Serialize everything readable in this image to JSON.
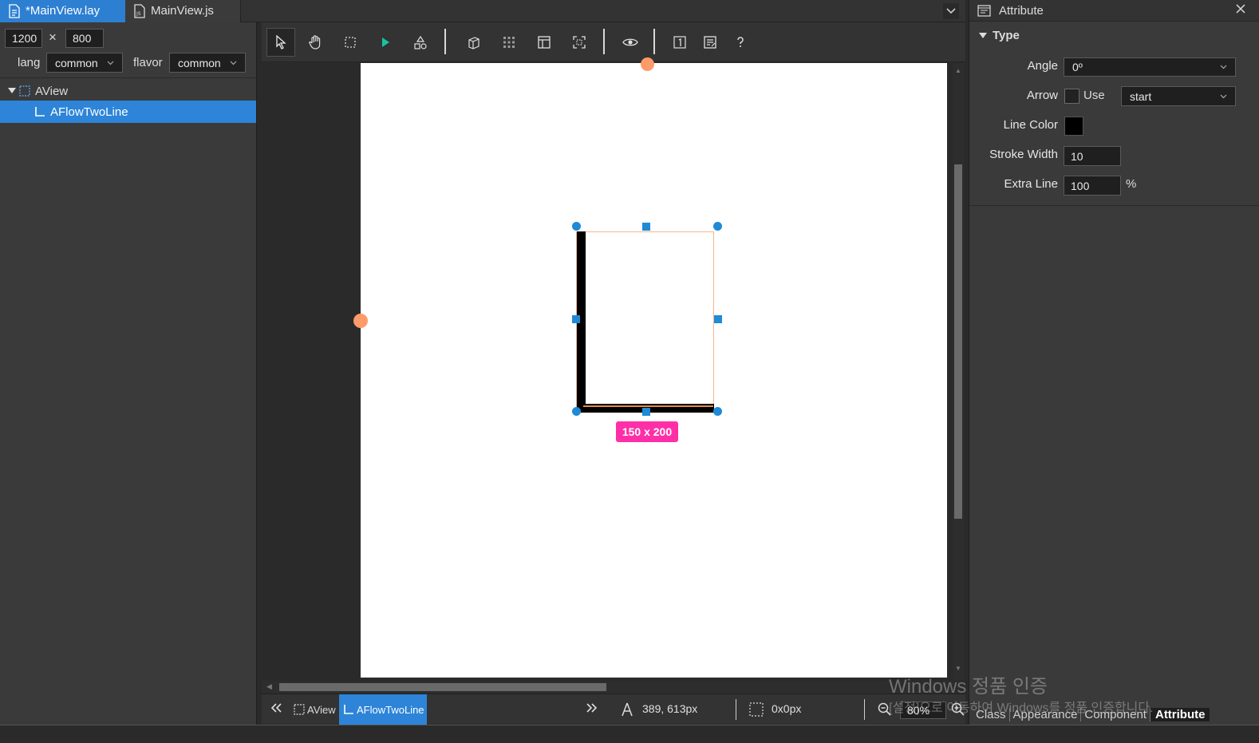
{
  "tabs": [
    {
      "label": "*MainView.lay",
      "active": true
    },
    {
      "label": "MainView.js",
      "active": false
    }
  ],
  "size": {
    "width": "1200",
    "times": "×",
    "height": "800"
  },
  "lang": {
    "label": "lang",
    "value": "common"
  },
  "flavor": {
    "label": "flavor",
    "value": "common"
  },
  "tree": [
    {
      "label": "AView",
      "selected": false
    },
    {
      "label": "AFlowTwoLine",
      "selected": true
    }
  ],
  "canvas": {
    "size_badge": "150 x 200"
  },
  "scroll": {
    "horizontal_fraction": 0.47,
    "vertical_fraction": 0.57
  },
  "status": {
    "crumbs": [
      "AView",
      "AFlowTwoLine"
    ],
    "cursor_pos": "389, 613px",
    "selection_size": "0x0px",
    "zoom": "80%"
  },
  "attribute_panel": {
    "title": "Attribute",
    "section": "Type",
    "angle_label": "Angle",
    "angle_value": "0º",
    "arrow_label": "Arrow",
    "arrow_use": "Use",
    "arrow_value": "start",
    "line_color_label": "Line Color",
    "line_color": "#000000",
    "stroke_width_label": "Stroke Width",
    "stroke_width": "10",
    "extra_line_label": "Extra Line",
    "extra_line": "100",
    "extra_line_unit": "%"
  },
  "bottom_tabs": [
    "Class",
    "Appearance",
    "Component",
    "Attribute"
  ],
  "watermark": {
    "line1": "Windows 정품 인증",
    "line2": "[설정]으로 이동하여 Windows를 정품 인증합니다."
  },
  "colors": {
    "accent": "#2d84d8",
    "handle": "#1f8ad6",
    "anchor": "#ff9a6a",
    "badge": "#ff2fa8"
  }
}
